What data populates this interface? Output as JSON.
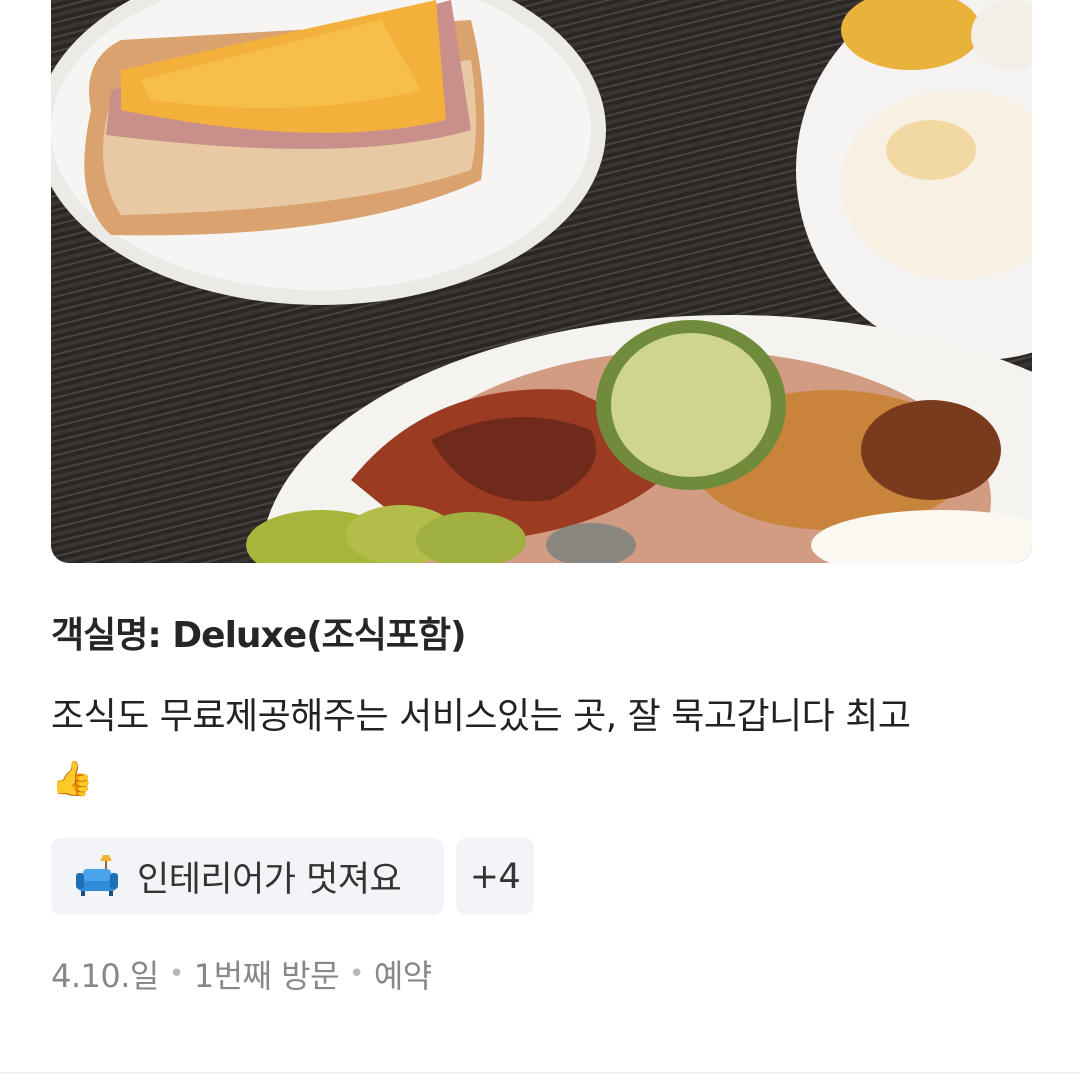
{
  "review": {
    "photo_icon": "breakfast-photo",
    "room_name": "객실명: Deluxe(조식포함)",
    "text": "조식도 무료제공해주는 서비스있는 곳, 잘 묵고갑니다 최고",
    "emoji": "👍",
    "tags": [
      {
        "icon": "sofa-icon",
        "label": "인테리어가 멋져요"
      }
    ],
    "more_tags_label": "+4",
    "meta": {
      "date": "4.10.일",
      "visit": "1번째 방문",
      "type": "예약"
    }
  },
  "colors": {
    "tag_bg": "#f2f4f7",
    "meta_text": "#888888",
    "title_text": "#262626"
  }
}
